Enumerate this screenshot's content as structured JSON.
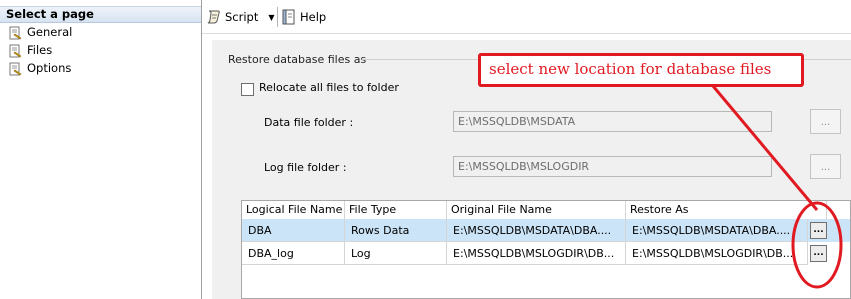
{
  "sidebar": {
    "header": "Select a page",
    "items": [
      {
        "label": "General",
        "icon": "page-wrench-icon"
      },
      {
        "label": "Files",
        "icon": "page-wrench-icon"
      },
      {
        "label": "Options",
        "icon": "page-wrench-icon"
      }
    ]
  },
  "toolbar": {
    "script_label": "Script",
    "help_label": "Help"
  },
  "restore": {
    "section_title": "Restore database files as",
    "relocate_label": "Relocate all files to folder",
    "relocate_checked": false,
    "data_folder_label": "Data file folder :",
    "data_folder_value": "E:\\MSSQLDB\\MSDATA",
    "log_folder_label": "Log file folder :",
    "log_folder_value": "E:\\MSSQLDB\\MSLOGDIR",
    "browse_label": "..."
  },
  "grid": {
    "columns": [
      "Logical File Name",
      "File Type",
      "Original File Name",
      "Restore As"
    ],
    "rows": [
      {
        "logical": "DBA",
        "type": "Rows Data",
        "original": "E:\\MSSQLDB\\MSDATA\\DBA....",
        "restore_as": "E:\\MSSQLDB\\MSDATA\\DBA....",
        "button": "..."
      },
      {
        "logical": "DBA_log",
        "type": "Log",
        "original": "E:\\MSSQLDB\\MSLOGDIR\\DB...",
        "restore_as": "E:\\MSSQLDB\\MSLOGDIR\\DB...",
        "button": "..."
      }
    ]
  },
  "annotation": {
    "text": "select new location for database files",
    "color": "#e11a22"
  },
  "colors": {
    "selected_row": "#cce4f7",
    "panel_bg": "#f0f0f0"
  }
}
